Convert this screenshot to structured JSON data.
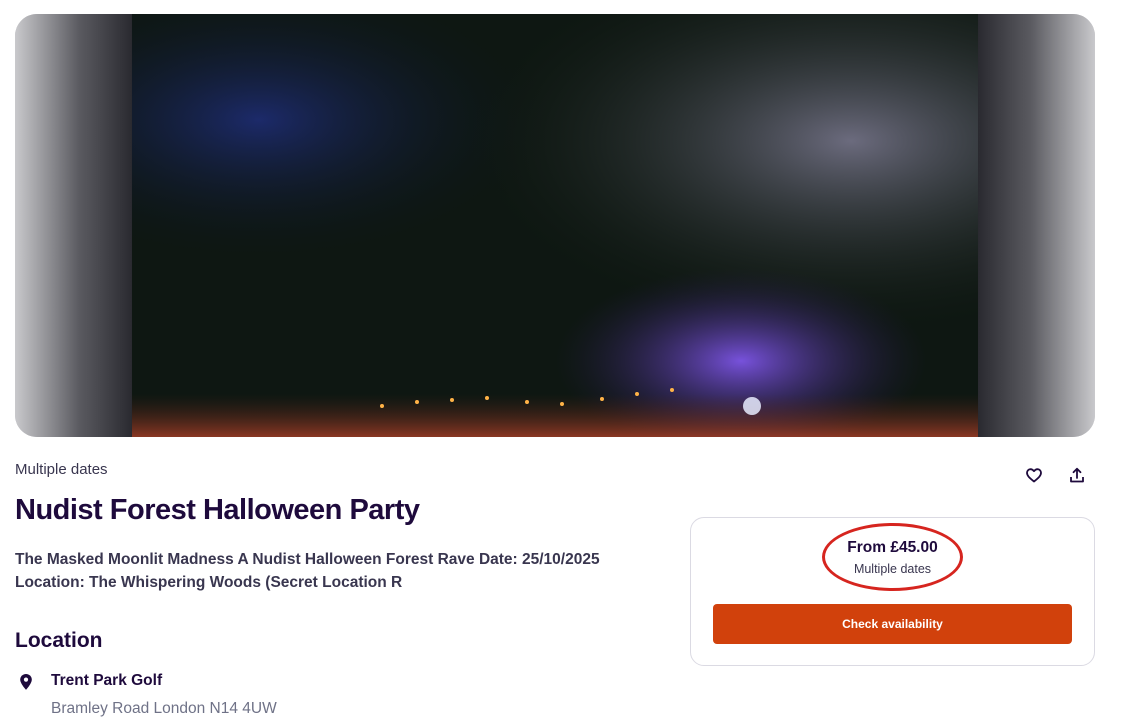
{
  "event": {
    "date_label": "Multiple dates",
    "title": "Nudist Forest Halloween Party",
    "summary": "The Masked Moonlit Madness A Nudist Halloween Forest Rave  Date: 25/10/2025 Location: The Whispering Woods (Secret Location R"
  },
  "location": {
    "heading": "Location",
    "venue": "Trent Park Golf",
    "address": "Bramley Road London N14 4UW",
    "icon": "map-pin-icon"
  },
  "ticket": {
    "price": "From £45.00",
    "sub": "Multiple dates",
    "button": "Check availability"
  },
  "actions": {
    "like_icon": "heart-icon",
    "share_icon": "share-icon"
  },
  "colors": {
    "accent": "#d1410c",
    "title": "#1e0a3c",
    "annotation": "#d6251f"
  }
}
